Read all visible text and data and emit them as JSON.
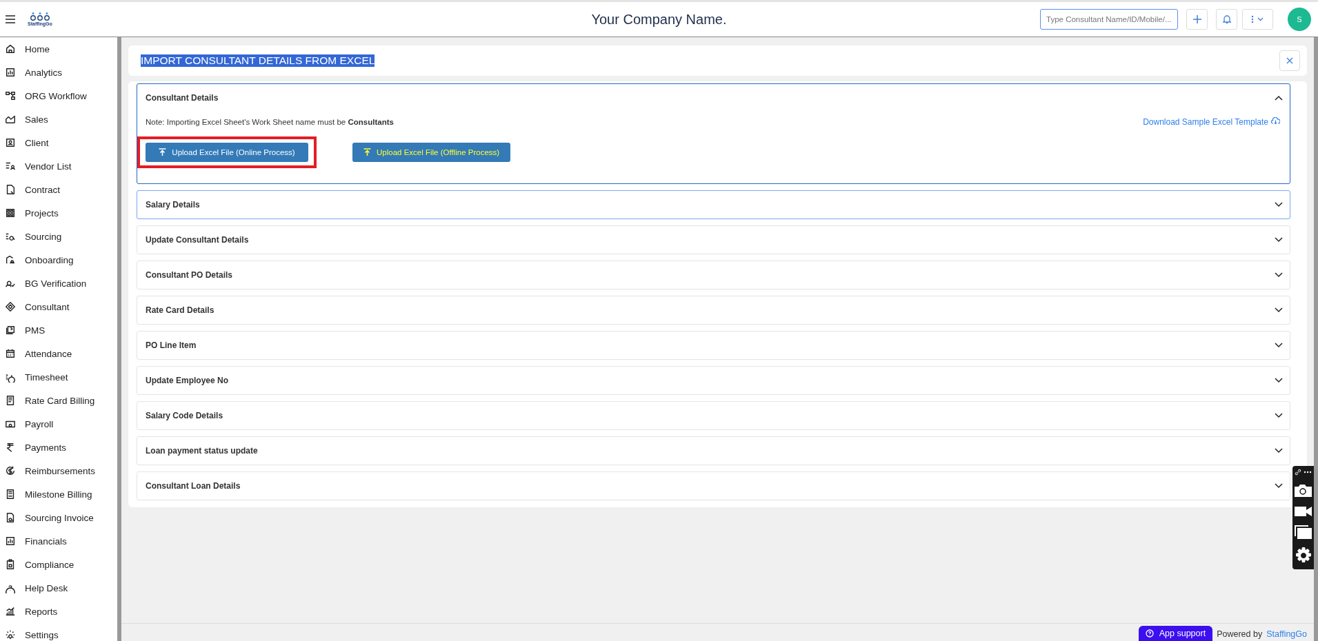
{
  "header": {
    "logo_text": "StaffingGo",
    "company": "Your Company Name.",
    "search": {
      "placeholder": "Type Consultant Name/ID/Mobile/..."
    },
    "avatar": "S"
  },
  "sidebar": {
    "items": [
      {
        "label": "Home"
      },
      {
        "label": "Analytics"
      },
      {
        "label": "ORG Workflow"
      },
      {
        "label": "Sales"
      },
      {
        "label": "Client"
      },
      {
        "label": "Vendor List"
      },
      {
        "label": "Contract"
      },
      {
        "label": "Projects"
      },
      {
        "label": "Sourcing"
      },
      {
        "label": "Onboarding"
      },
      {
        "label": "BG Verification"
      },
      {
        "label": "Consultant"
      },
      {
        "label": "PMS"
      },
      {
        "label": "Attendance"
      },
      {
        "label": "Timesheet"
      },
      {
        "label": "Rate Card Billing"
      },
      {
        "label": "Payroll"
      },
      {
        "label": "Payments"
      },
      {
        "label": "Reimbursements"
      },
      {
        "label": "Milestone Billing"
      },
      {
        "label": "Sourcing Invoice"
      },
      {
        "label": "Financials"
      },
      {
        "label": "Compliance"
      },
      {
        "label": "Help Desk"
      },
      {
        "label": "Reports"
      },
      {
        "label": "Settings"
      }
    ]
  },
  "page": {
    "title": "IMPORT CONSULTANT DETAILS FROM EXCEL",
    "title_selected": true
  },
  "sections": [
    {
      "title": "Consultant Details",
      "expanded": true,
      "focused": false,
      "note": "Note: Importing Excel Sheet's Work Sheet name must be **Consultants**",
      "download_link": "Download Sample Excel Template",
      "buttons": [
        {
          "label": "Upload Excel File (Online Process)",
          "kind": "online",
          "outlined": true
        },
        {
          "label": "Upload Excel File (Offline Process)",
          "kind": "offline",
          "outlined": false
        }
      ]
    },
    {
      "title": "Salary Details",
      "expanded": false,
      "focused": true
    },
    {
      "title": "Update Consultant Details",
      "expanded": false,
      "focused": false
    },
    {
      "title": "Consultant PO Details",
      "expanded": false,
      "focused": false
    },
    {
      "title": "Rate Card Details",
      "expanded": false,
      "focused": false
    },
    {
      "title": "PO Line Item",
      "expanded": false,
      "focused": false
    },
    {
      "title": "Update Employee No",
      "expanded": false,
      "focused": false
    },
    {
      "title": "Salary Code Details",
      "expanded": false,
      "focused": false
    },
    {
      "title": "Loan payment status update",
      "expanded": false,
      "focused": false
    },
    {
      "title": "Consultant Loan Details",
      "expanded": false,
      "focused": false
    }
  ],
  "footer": {
    "support": "App support",
    "powered": "Powered by",
    "brand": "StaffingGo"
  }
}
